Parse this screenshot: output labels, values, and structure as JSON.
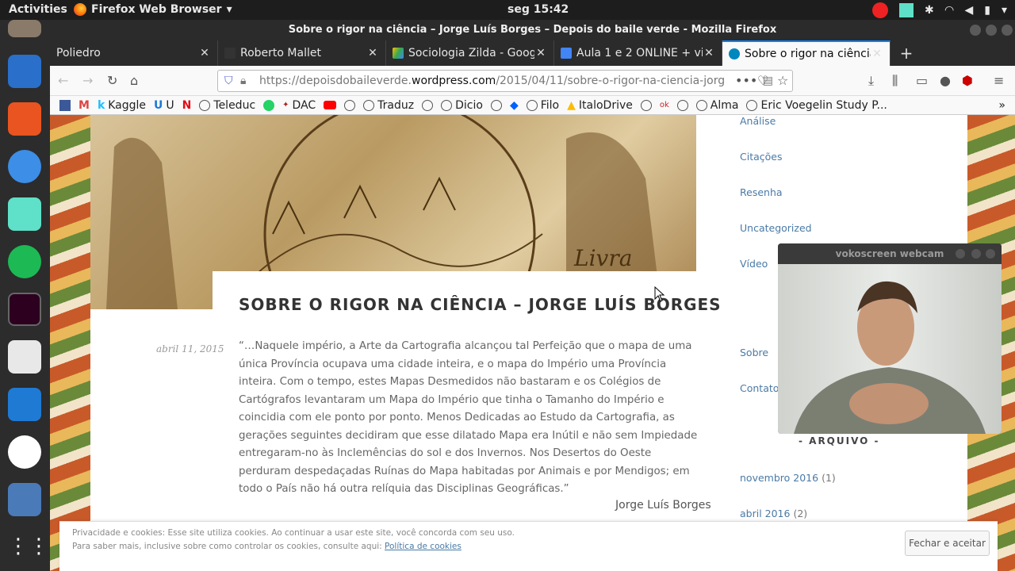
{
  "topbar": {
    "activities": "Activities",
    "app": "Firefox Web Browser",
    "clock": "seg 15:42"
  },
  "window": {
    "title": "Sobre o rigor na ciência – Jorge Luís Borges – Depois do baile verde - Mozilla Firefox"
  },
  "tabs": [
    {
      "label": "Poliedro"
    },
    {
      "label": "Roberto Mallet"
    },
    {
      "label": "Sociologia Zilda - Google"
    },
    {
      "label": "Aula 1 e 2 ONLINE + vide"
    },
    {
      "label": "Sobre o rigor na ciência -"
    }
  ],
  "url": {
    "pre": "https://depoisdobaileverde.",
    "host": "wordpress.com",
    "path": "/2015/04/11/sobre-o-rigor-na-ciencia-jorg"
  },
  "bookmarks": [
    "Kaggle",
    "U",
    "Teleduc",
    "DAC",
    "Traduz",
    "Dicio",
    "Filo",
    "ItaloDrive",
    "Alma",
    "Eric Voegelin Study P..."
  ],
  "post": {
    "title": "SOBRE O RIGOR NA CIÊNCIA – JORGE LUÍS BORGES",
    "date": "abril 11, 2015",
    "quote": "“…Naquele império, a Arte da Cartografia alcançou tal Perfeição que o mapa de uma única Província ocupava uma cidade inteira, e o mapa do Império uma Província inteira. Com o tempo, estes Mapas Desmedidos não bastaram e os Colégios de Cartógrafos levantaram um Mapa do Império que tinha o Tamanho do Império e coincidia com ele ponto por ponto. Menos Dedicadas ao Estudo da Cartografia, as gerações seguintes decidiram que esse dilatado Mapa era Inútil e não sem Impiedade entregaram-no às Inclemências do sol e dos Invernos. Nos Desertos do Oeste perduram despedaçadas Ruínas do Mapa habitadas por Animais e por Mendigos; em todo o País não há outra relíquia das Disciplinas Geográficas.”",
    "author": "Jorge Luís Borges"
  },
  "sidebar": {
    "categories": [
      "Análise",
      "Citações",
      "Resenha",
      "Uncategorized",
      "Vídeo"
    ],
    "pages": [
      "Sobre",
      "Contato"
    ],
    "archive_heading": "- ARQUIVO -",
    "archive": [
      {
        "label": "novembro 2016",
        "count": "(1)"
      },
      {
        "label": "abril 2016",
        "count": "(2)"
      }
    ]
  },
  "webcam": {
    "title": "vokoscreen webcam"
  },
  "cookie": {
    "line1": "Privacidade e cookies: Esse site utiliza cookies. Ao continuar a usar este site, você concorda com seu uso.",
    "line2": "Para saber mais, inclusive sobre como controlar os cookies, consulte aqui:",
    "link": "Política de cookies",
    "button": "Fechar e aceitar"
  }
}
